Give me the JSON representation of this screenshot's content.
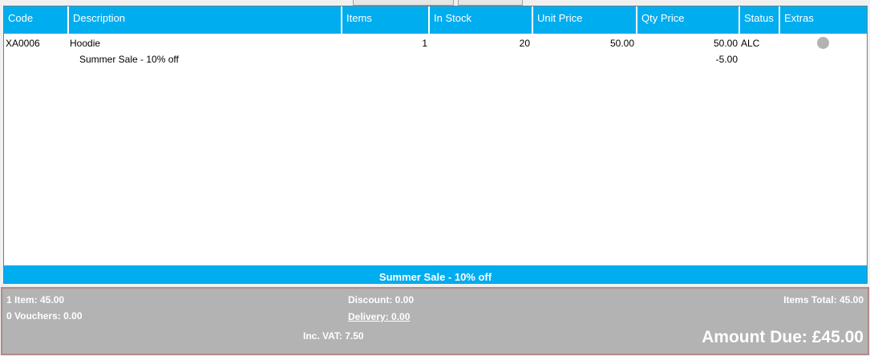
{
  "table": {
    "columns": [
      "Code",
      "Description",
      "Items",
      "In Stock",
      "Unit Price",
      "Qty Price",
      "Status",
      "Extras"
    ],
    "rows": [
      {
        "code": "XA0006",
        "description": "Hoodie",
        "items": "1",
        "in_stock": "20",
        "unit_price": "50.00",
        "qty_price": "50.00",
        "status": "ALC",
        "extras_icon": "status-dot-icon"
      }
    ],
    "sub_lines": [
      {
        "description": "Summer Sale - 10% off",
        "qty_price": "-5.00"
      }
    ]
  },
  "promo_bar": "Summer Sale - 10% off",
  "summary": {
    "items_line": "1 Item: 45.00",
    "vouchers_line": "0 Vouchers: 0.00",
    "discount_line": "Discount: 0.00",
    "delivery_label": "Delivery:",
    "delivery_value": "0.00",
    "vat_line": "Inc. VAT: 7.50",
    "items_total_line": "Items Total: 45.00",
    "amount_due_line": "Amount Due: £45.00"
  },
  "colors": {
    "header_blue": "#00adef",
    "summary_grey": "#b3b3b3",
    "extras_dot": "#b3b3b3"
  }
}
